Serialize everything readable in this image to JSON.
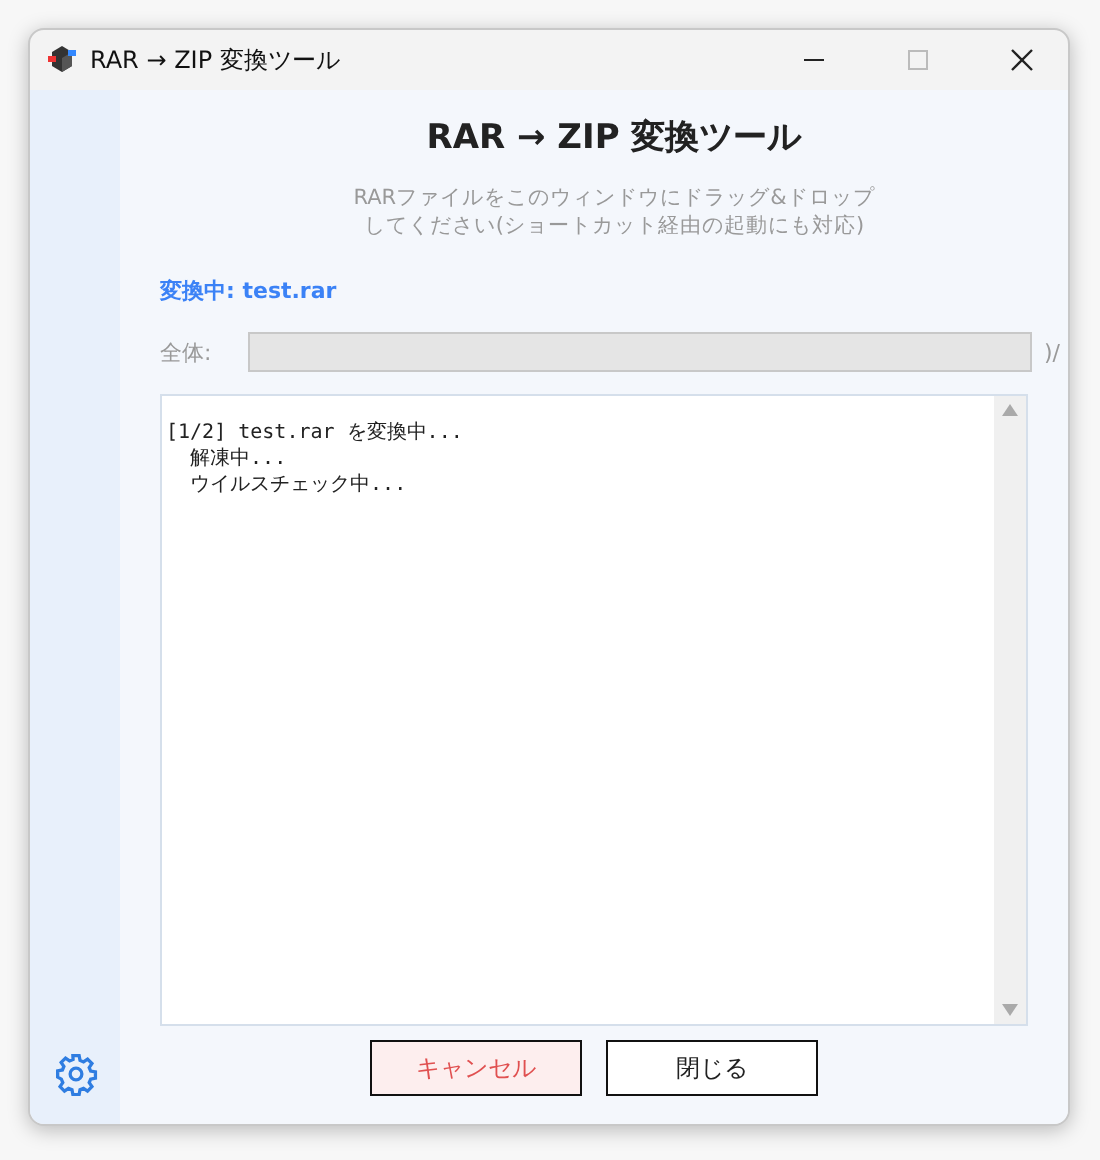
{
  "window": {
    "title": "RAR → ZIP 変換ツール"
  },
  "heading": "RAR → ZIP 変換ツール",
  "instructions": [
    "RARファイルをこのウィンドウにドラッグ&ドロップ",
    "してください(ショートカット経由の起動にも対応)"
  ],
  "status": "変換中: test.rar",
  "progress": {
    "label": "全体:",
    "reading": ")/"
  },
  "log": [
    "[1/2] test.rar を変換中...",
    "  解凍中...",
    "  ウイルスチェック中..."
  ],
  "buttons": [
    {
      "label": "キャンセル",
      "kind": "danger"
    },
    {
      "label": "閉じる",
      "kind": "normal"
    }
  ]
}
